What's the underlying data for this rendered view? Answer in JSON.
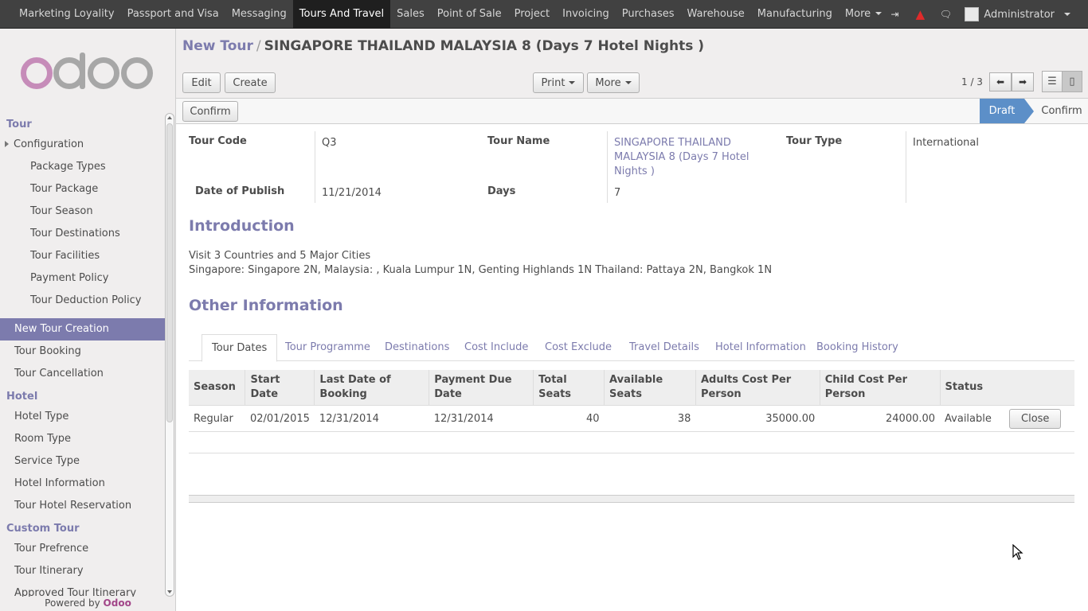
{
  "topbar": {
    "menus": [
      "Marketing Loyality",
      "Passport and Visa",
      "Messaging",
      "Tours And Travel",
      "Sales",
      "Point of Sale",
      "Project",
      "Invoicing",
      "Purchases",
      "Warehouse",
      "Manufacturing"
    ],
    "active_menu": "Tours And Travel",
    "more_label": "More",
    "user_name": "Administrator"
  },
  "sidebar": {
    "sections": [
      {
        "title": "Tour",
        "items": [
          {
            "label": "Configuration",
            "kind": "folder"
          },
          {
            "label": "Package Types",
            "kind": "sub"
          },
          {
            "label": "Tour Package",
            "kind": "sub"
          },
          {
            "label": "Tour Season",
            "kind": "sub"
          },
          {
            "label": "Tour Destinations",
            "kind": "sub"
          },
          {
            "label": "Tour Facilities",
            "kind": "sub"
          },
          {
            "label": "Payment Policy",
            "kind": "sub"
          },
          {
            "label": "Tour Deduction Policy",
            "kind": "sub"
          },
          {
            "label": "New Tour Creation",
            "kind": "active"
          },
          {
            "label": "Tour Booking",
            "kind": "item"
          },
          {
            "label": "Tour Cancellation",
            "kind": "item"
          }
        ]
      },
      {
        "title": "Hotel",
        "items": [
          {
            "label": "Hotel Type",
            "kind": "item"
          },
          {
            "label": "Room Type",
            "kind": "item"
          },
          {
            "label": "Service Type",
            "kind": "item"
          },
          {
            "label": "Hotel Information",
            "kind": "item"
          },
          {
            "label": "Tour Hotel Reservation",
            "kind": "item"
          }
        ]
      },
      {
        "title": "Custom Tour",
        "items": [
          {
            "label": "Tour Prefrence",
            "kind": "item"
          },
          {
            "label": "Tour Itinerary",
            "kind": "item"
          },
          {
            "label": "Approved Tour Itinerary",
            "kind": "item"
          }
        ]
      }
    ],
    "powered_prefix": "Powered by",
    "powered_brand": "Odoo"
  },
  "control": {
    "breadcrumb_parent": "New Tour",
    "breadcrumb_sep": "/",
    "breadcrumb_current": "SINGAPORE THAILAND MALAYSIA 8 (Days 7 Hotel Nights )",
    "edit_label": "Edit",
    "create_label": "Create",
    "print_label": "Print",
    "more_label": "More",
    "pager": "1 / 3",
    "confirm_label": "Confirm",
    "stages": [
      "Draft",
      "Confirm"
    ]
  },
  "form": {
    "tour_code_label": "Tour Code",
    "tour_code": "Q3",
    "tour_name_label": "Tour Name",
    "tour_name": "SINGAPORE THAILAND MALAYSIA 8 (Days 7 Hotel Nights )",
    "tour_type_label": "Tour Type",
    "tour_type": "International",
    "date_publish_label": "Date of Publish",
    "date_publish": "11/21/2014",
    "days_label": "Days",
    "days": "7",
    "intro_heading": "Introduction",
    "intro_line1": "Visit 3 Countries and 5 Major Cities",
    "intro_line2": "Singapore: Singapore 2N, Malaysia: , Kuala Lumpur 1N, Genting Highlands 1N Thailand: Pattaya 2N, Bangkok 1N",
    "other_heading": "Other Information"
  },
  "tabs": [
    "Tour Dates",
    "Tour Programme",
    "Destinations",
    "Cost Include",
    "Cost Exclude",
    "Travel Details",
    "Hotel Information",
    "Booking History"
  ],
  "grid": {
    "columns": [
      "Season",
      "Start Date",
      "Last Date of Booking",
      "Payment Due Date",
      "Total Seats",
      "Available Seats",
      "Adults Cost Per Person",
      "Child Cost Per Person",
      "Status"
    ],
    "rows": [
      {
        "season": "Regular",
        "start": "02/01/2015",
        "last_booking": "12/31/2014",
        "payment_due": "12/31/2014",
        "total_seats": "40",
        "available_seats": "38",
        "adult_cost": "35000.00",
        "child_cost": "24000.00",
        "status": "Available",
        "action": "Close"
      }
    ]
  }
}
